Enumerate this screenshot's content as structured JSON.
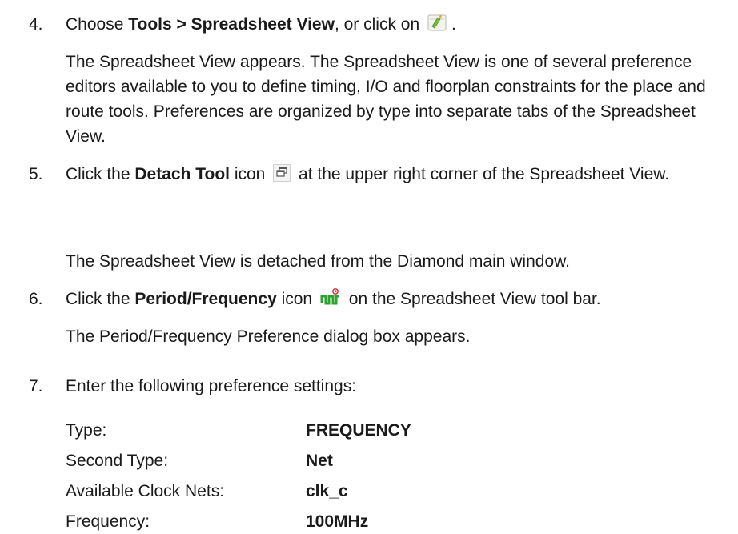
{
  "steps": [
    {
      "number": "4.",
      "pre": "Choose ",
      "bold": "Tools > Spreadsheet View",
      "post": ", or click on",
      "end": ".",
      "icon": "spreadsheet-view-icon",
      "result": "The Spreadsheet View appears. The Spreadsheet View is one of several preference editors available to you to define timing, I/O and floorplan constraints for the place and route tools. Preferences are organized by type into separate tabs of the Spreadsheet View."
    },
    {
      "number": "5.",
      "pre": "Click the ",
      "bold": "Detach Tool",
      "mid": " icon",
      "post": " at the upper right corner of the Spreadsheet View.",
      "icon": "detach-tool-icon",
      "result": "The Spreadsheet View is detached from the Diamond main window."
    },
    {
      "number": "6.",
      "pre": "Click the ",
      "bold": "Period/Frequency",
      "mid": " icon",
      "post": " on the Spreadsheet View tool bar.",
      "icon": "period-frequency-icon",
      "result": "The Period/Frequency Preference dialog box appears."
    },
    {
      "number": "7.",
      "text": "Enter the following preference settings:"
    }
  ],
  "settings": [
    {
      "label": "Type:",
      "value": "FREQUENCY"
    },
    {
      "label": "Second Type:",
      "value": "Net"
    },
    {
      "label": "Available Clock Nets:",
      "value": "clk_c"
    },
    {
      "label": "Frequency:",
      "value": "100MHz"
    }
  ]
}
